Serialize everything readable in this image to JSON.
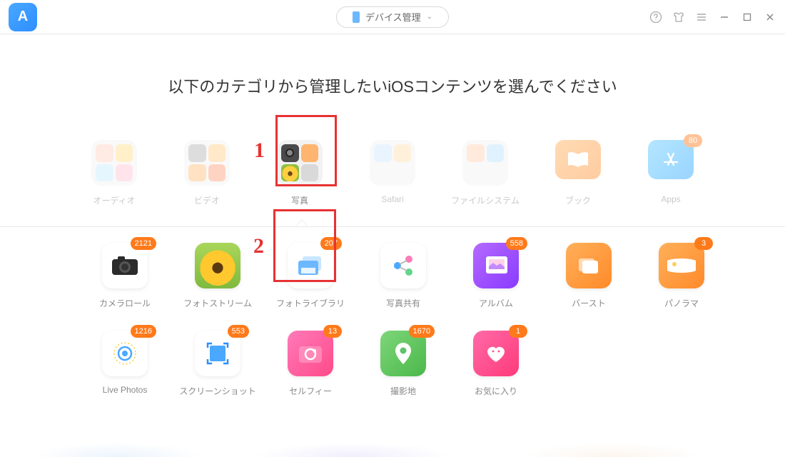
{
  "header": {
    "device_label": "デバイス管理"
  },
  "title": "以下のカテゴリから管理したいiOSコンテンツを選んでください",
  "annotations": {
    "n1": "1",
    "n2": "2"
  },
  "top_categories": [
    {
      "key": "audio",
      "label": "オーディオ",
      "faded": true
    },
    {
      "key": "video",
      "label": "ビデオ",
      "faded": true
    },
    {
      "key": "photo",
      "label": "写真",
      "faded": false,
      "highlighted": true
    },
    {
      "key": "safari",
      "label": "Safari",
      "faded": true
    },
    {
      "key": "files",
      "label": "ファイルシステム",
      "faded": true
    },
    {
      "key": "books",
      "label": "ブック",
      "faded": true
    },
    {
      "key": "apps",
      "label": "Apps",
      "faded": true,
      "badge": "80"
    }
  ],
  "sub_row1": [
    {
      "key": "cameraroll",
      "label": "カメラロール",
      "badge": "2121"
    },
    {
      "key": "photostream",
      "label": "フォトストリーム"
    },
    {
      "key": "photolibrary",
      "label": "フォトライブラリ",
      "badge": "207",
      "highlighted": true
    },
    {
      "key": "shared",
      "label": "写真共有"
    },
    {
      "key": "albums",
      "label": "アルバム",
      "badge": "558"
    },
    {
      "key": "burst",
      "label": "バースト"
    },
    {
      "key": "panorama",
      "label": "パノラマ",
      "badge": "3"
    }
  ],
  "sub_row2": [
    {
      "key": "livephotos",
      "label": "Live Photos",
      "badge": "1216"
    },
    {
      "key": "screenshots",
      "label": "スクリーンショット",
      "badge": "553"
    },
    {
      "key": "selfies",
      "label": "セルフィー",
      "badge": "13"
    },
    {
      "key": "places",
      "label": "撮影地",
      "badge": "1670"
    },
    {
      "key": "favorites",
      "label": "お気に入り",
      "badge": "1"
    }
  ]
}
